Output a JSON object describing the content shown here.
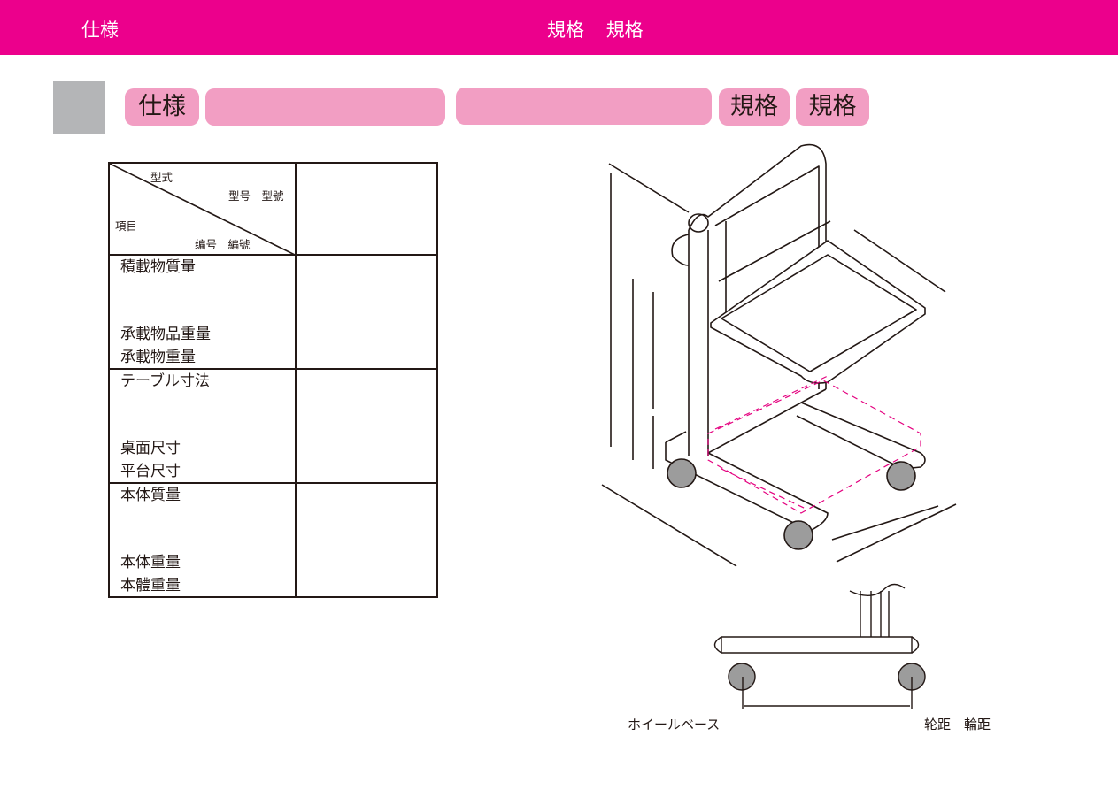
{
  "header": {
    "title_left": "仕様",
    "title_right": [
      "規格",
      "規格"
    ],
    "color": "#ec008c"
  },
  "section_tabs": {
    "tab1": "仕様",
    "tab2": "",
    "tab3": "",
    "tab4": "規格",
    "tab5": "規格",
    "color": "#f29ec3"
  },
  "spec_table": {
    "header": {
      "model_label": "型式",
      "model_variants": "型号　型號",
      "item_label": "項目",
      "number_variants": "编号　編號",
      "value": ""
    },
    "rows": [
      {
        "labels": [
          "積載物質量",
          "承載物品重量",
          "承載物重量"
        ],
        "value": ""
      },
      {
        "labels": [
          "テーブル寸法",
          "桌面尺寸",
          "平台尺寸"
        ],
        "value": ""
      },
      {
        "labels": [
          "本体質量",
          "本体重量",
          "本體重量"
        ],
        "value": ""
      }
    ]
  },
  "diagram": {
    "wheelbase_label_ja": "ホイールベース",
    "wheelbase_label_zh": "轮距　輪距"
  }
}
